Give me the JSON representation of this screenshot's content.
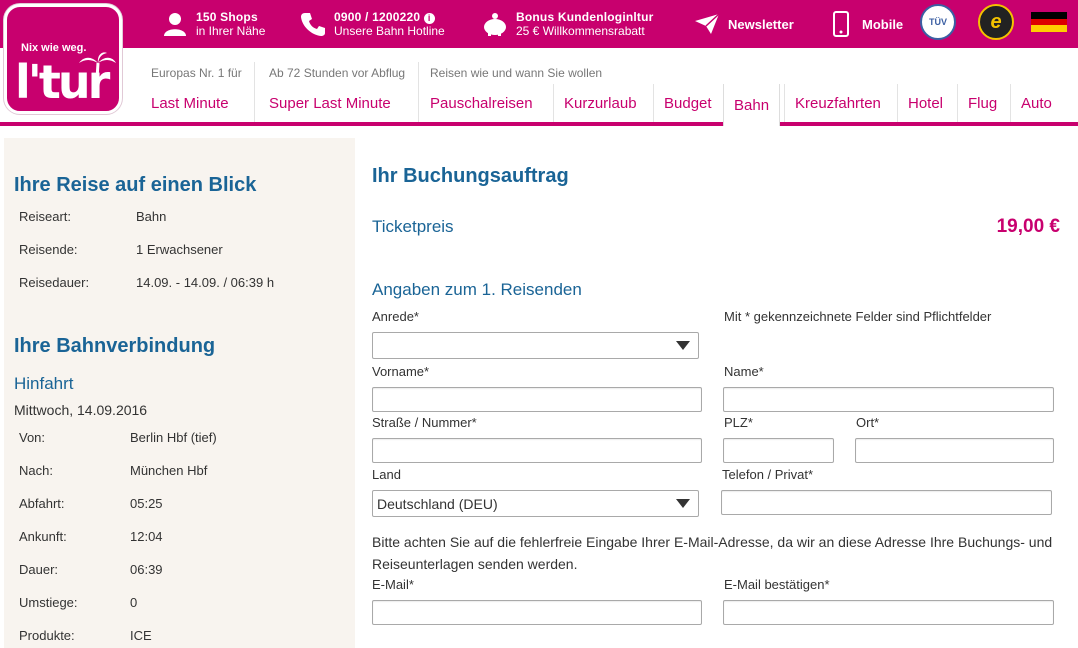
{
  "topbar": {
    "shops": {
      "line1": "150 Shops",
      "line2": "in Ihrer Nähe",
      "icon": "person-icon"
    },
    "hotline": {
      "line1": "0900 / 1200220",
      "line2": "Unsere Bahn Hotline",
      "icon": "phone-icon"
    },
    "bonus": {
      "line1": "Bonus Kundenloginltur",
      "line2": "25 € Willkommensrabatt",
      "icon": "piggybank-icon"
    },
    "newsletter": {
      "label": "Newsletter",
      "icon": "paper-plane-icon"
    },
    "mobile": {
      "label": "Mobile",
      "icon": "smartphone-icon"
    },
    "badges": [
      {
        "name": "tuev-badge",
        "text": "TÜV"
      },
      {
        "name": "trusted-shops-badge",
        "text": "e"
      }
    ],
    "flag": "germany-flag"
  },
  "logo": {
    "slogan": "Nix wie weg.",
    "brand": "l'tur"
  },
  "nav": {
    "groups": [
      {
        "sub": "Europas Nr. 1 für",
        "tabs": [
          "Last Minute"
        ]
      },
      {
        "sub": "Ab 72 Stunden vor Abflug",
        "tabs": [
          "Super Last Minute"
        ]
      },
      {
        "sub": "Reisen wie und wann Sie wollen",
        "tabs": [
          "Pauschalreisen",
          "Kurzurlaub",
          "Budget",
          "Bahn",
          "Kreuzfahrten",
          "Hotel",
          "Flug",
          "Auto"
        ]
      }
    ],
    "active": "Bahn"
  },
  "sidebar": {
    "overview_title": "Ihre Reise auf einen Blick",
    "overview": [
      {
        "k": "Reiseart:",
        "v": "Bahn"
      },
      {
        "k": "Reisende:",
        "v": "1 Erwachsener"
      },
      {
        "k": "Reisedauer:",
        "v": "14.09. - 14.09. / 06:39 h"
      }
    ],
    "connection_title": "Ihre Bahnverbindung",
    "outbound_title": "Hinfahrt",
    "outbound_date": "Mittwoch, 14.09.2016",
    "outbound": [
      {
        "k": "Von:",
        "v": "Berlin Hbf (tief)"
      },
      {
        "k": "Nach:",
        "v": "München Hbf"
      },
      {
        "k": "Abfahrt:",
        "v": "05:25"
      },
      {
        "k": "Ankunft:",
        "v": "12:04"
      },
      {
        "k": "Dauer:",
        "v": "06:39"
      },
      {
        "k": "Umstiege:",
        "v": "0"
      },
      {
        "k": "Produkte:",
        "v": "ICE"
      }
    ]
  },
  "main": {
    "title": "Ihr Buchungsauftrag",
    "price_label": "Ticketpreis",
    "price_value": "19,00 €",
    "section_title": "Angaben zum 1. Reisenden",
    "required_note": "Mit * gekennzeichnete Felder sind Pflichtfelder",
    "labels": {
      "salutation": "Anrede*",
      "firstname": "Vorname*",
      "lastname": "Name*",
      "street": "Straße / Nummer*",
      "zip": "PLZ*",
      "city": "Ort*",
      "country": "Land",
      "phone": "Telefon / Privat*",
      "email": "E-Mail*",
      "email_confirm": "E-Mail bestätigen*"
    },
    "salutation_value": "",
    "country_value": "Deutschland (DEU)",
    "email_hint": "Bitte achten Sie auf die fehlerfreie Eingabe Ihrer E-Mail-Adresse, da wir an diese Adresse Ihre Buchungs- und Reiseunterlagen senden werden."
  }
}
